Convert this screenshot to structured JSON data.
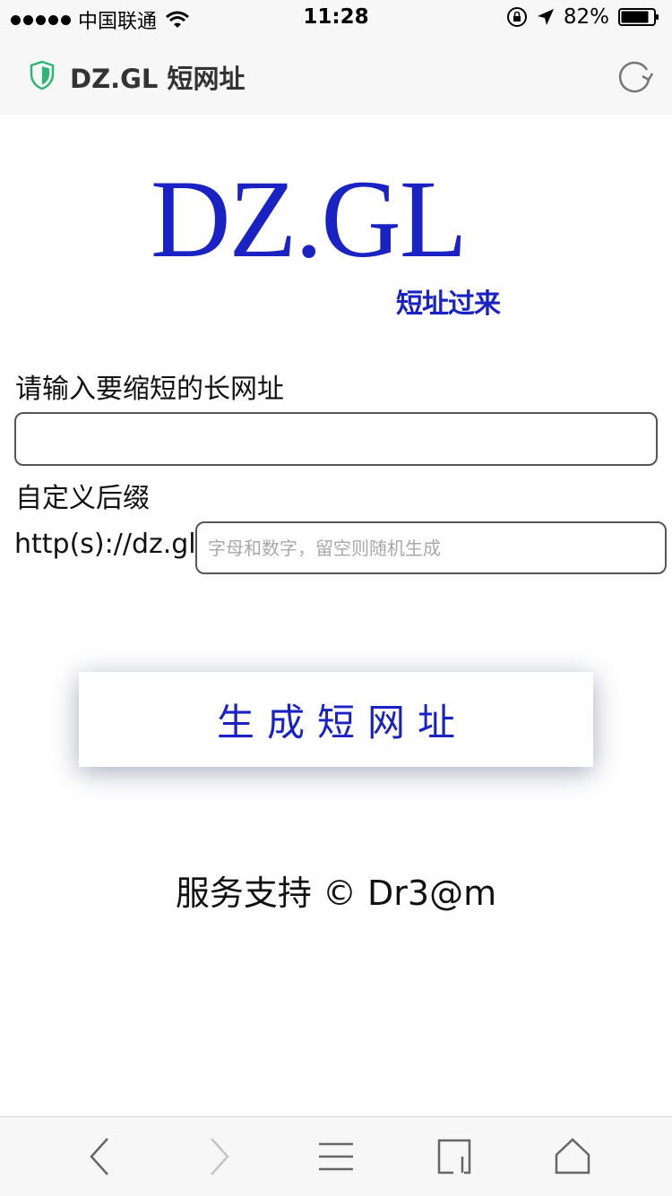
{
  "status_bar": {
    "carrier": "中国联通",
    "time": "11:28",
    "battery": "82%"
  },
  "browser": {
    "site_title": "DZ.GL 短网址"
  },
  "logo": {
    "main": "DZ.GL",
    "tagline": "短址过来"
  },
  "form": {
    "url_label": "请输入要缩短的长网址",
    "url_value": "",
    "suffix_label": "自定义后缀",
    "prefix": "http(s)://dz.gl/",
    "suffix_placeholder": "字母和数字，留空则随机生成",
    "suffix_value": "",
    "submit_label": "生成短网址"
  },
  "footer": {
    "text": "服务支持 © Dr3@m"
  },
  "colors": {
    "brand_blue": "#1a22c4",
    "bar_bg": "#f7f7f7",
    "shield_green": "#2bb673"
  },
  "toolbar": {
    "icons": [
      "back-icon",
      "forward-icon",
      "menu-icon",
      "tabs-icon",
      "home-icon"
    ]
  }
}
